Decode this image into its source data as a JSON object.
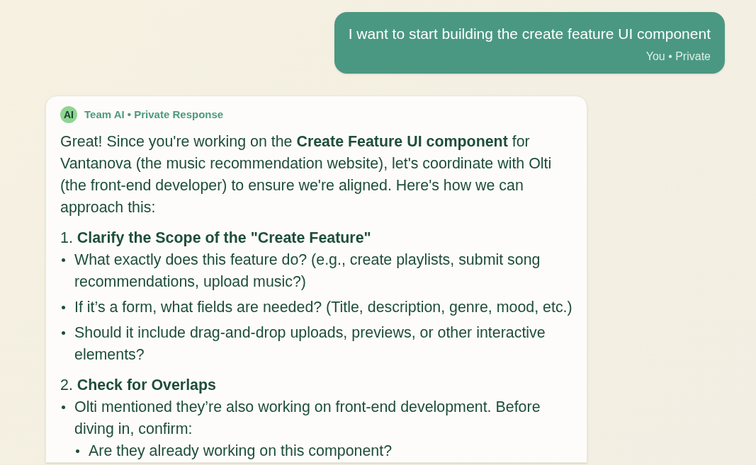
{
  "user_message": {
    "text": "I want to start building the create feature UI component",
    "meta": "You • Private"
  },
  "ai_message": {
    "avatar": "AI",
    "meta": "Team AI • Private Response",
    "intro": "Great! Since you're working on the **Create Feature UI component** for Vantanova (the music recommendation website), let's coordinate with Olti (the front-end developer) to ensure we're aligned. Here's how we can approach this:",
    "sections": [
      {
        "heading": "1. **Clarify the Scope of the \"Create Feature\"**",
        "items": [
          {
            "text": "What exactly does this feature do? (e.g., create playlists, submit song recommendations, upload music?)"
          },
          {
            "text": "If it’s a form, what fields are needed? (Title, description, genre, mood, etc.)"
          },
          {
            "text": "Should it include drag-and-drop uploads, previews, or other interactive elements?"
          }
        ]
      },
      {
        "heading": "2. **Check for Overlaps**",
        "items": [
          {
            "text": "Olti mentioned they’re also working on front-end development. Before diving in, confirm:",
            "children": [
              {
                "text": "Are they already working on this component?"
              }
            ]
          }
        ]
      }
    ]
  }
}
